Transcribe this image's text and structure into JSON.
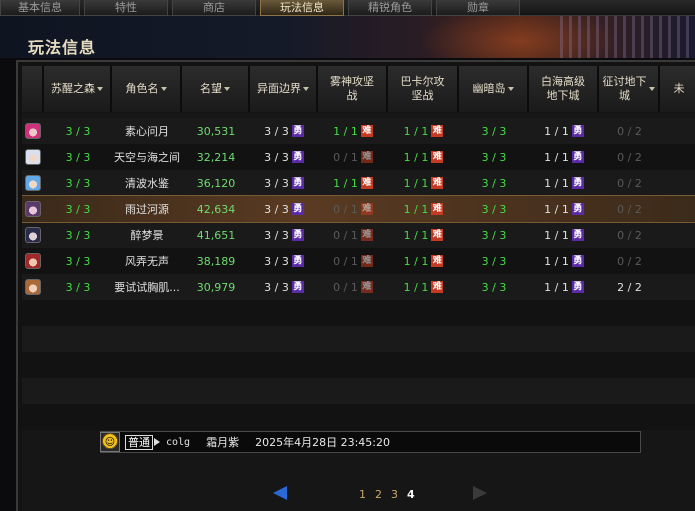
{
  "tabs": [
    {
      "label": "基本信息",
      "active": false
    },
    {
      "label": "特性",
      "active": false
    },
    {
      "label": "商店",
      "active": false
    },
    {
      "label": "玩法信息",
      "active": true
    },
    {
      "label": "精锐角色",
      "active": false
    },
    {
      "label": "勋章",
      "active": false
    }
  ],
  "page_title": "玩法信息",
  "table": {
    "headers": [
      "苏醒之森",
      "角色名",
      "名望",
      "异面边界",
      "雾神攻坚战",
      "巴卡尔攻坚战",
      "幽暗岛",
      "白海高级地下城",
      "征讨地下城",
      "未"
    ],
    "header_lines": [
      [
        "苏醒之森"
      ],
      [
        "角色名"
      ],
      [
        "名望"
      ],
      [
        "异面边界"
      ],
      [
        "雾神攻坚",
        "战"
      ],
      [
        "巴卡尔攻",
        "坚战"
      ],
      [
        "幽暗岛"
      ],
      [
        "白海高级",
        "地下城"
      ],
      [
        "征讨地下",
        "城"
      ],
      [
        "未"
      ]
    ],
    "rows": [
      {
        "avatar": "pink-hair",
        "forest": "3 / 3",
        "name": "素心问月",
        "fame": "30,531",
        "boundary": "3 / 3",
        "boundary_tag": "勇",
        "mist": "1 / 1",
        "mist_active": true,
        "mist_tag": "难",
        "bakal": "1 / 1",
        "bakal_tag": "难",
        "dark": "3 / 3",
        "white": "1 / 1",
        "white_tag": "勇",
        "conquest": "0 / 2"
      },
      {
        "avatar": "white-hair",
        "forest": "3 / 3",
        "name": "天空与海之间",
        "fame": "32,214",
        "boundary": "3 / 3",
        "boundary_tag": "勇",
        "mist": "0 / 1",
        "mist_active": false,
        "mist_tag": "难",
        "bakal": "1 / 1",
        "bakal_tag": "难",
        "dark": "3 / 3",
        "white": "1 / 1",
        "white_tag": "勇",
        "conquest": "0 / 2"
      },
      {
        "avatar": "blue-hair",
        "forest": "3 / 3",
        "name": "清波水鉴",
        "fame": "36,120",
        "boundary": "3 / 3",
        "boundary_tag": "勇",
        "mist": "1 / 1",
        "mist_active": true,
        "mist_tag": "难",
        "bakal": "1 / 1",
        "bakal_tag": "难",
        "dark": "3 / 3",
        "white": "1 / 1",
        "white_tag": "勇",
        "conquest": "0 / 2"
      },
      {
        "avatar": "dark-mage",
        "forest": "3 / 3",
        "name": "雨过河源",
        "fame": "42,634",
        "boundary": "3 / 3",
        "boundary_tag": "勇",
        "mist": "0 / 1",
        "mist_active": false,
        "mist_tag": "难",
        "bakal": "1 / 1",
        "bakal_tag": "难",
        "dark": "3 / 3",
        "white": "1 / 1",
        "white_tag": "勇",
        "conquest": "0 / 2",
        "selected": true
      },
      {
        "avatar": "dark-hat",
        "forest": "3 / 3",
        "name": "醉梦景",
        "fame": "41,651",
        "boundary": "3 / 3",
        "boundary_tag": "勇",
        "mist": "0 / 1",
        "mist_active": false,
        "mist_tag": "难",
        "bakal": "1 / 1",
        "bakal_tag": "难",
        "dark": "3 / 3",
        "white": "1 / 1",
        "white_tag": "勇",
        "conquest": "0 / 2"
      },
      {
        "avatar": "red-fighter",
        "forest": "3 / 3",
        "name": "风弄无声",
        "fame": "38,189",
        "boundary": "3 / 3",
        "boundary_tag": "勇",
        "mist": "0 / 1",
        "mist_active": false,
        "mist_tag": "难",
        "bakal": "1 / 1",
        "bakal_tag": "难",
        "dark": "3 / 3",
        "white": "1 / 1",
        "white_tag": "勇",
        "conquest": "0 / 2"
      },
      {
        "avatar": "brown-hair",
        "forest": "3 / 3",
        "name": "要试试胸肌...",
        "fame": "30,979",
        "boundary": "3 / 3",
        "boundary_tag": "勇",
        "mist": "0 / 1",
        "mist_active": false,
        "mist_tag": "难",
        "bakal": "1 / 1",
        "bakal_tag": "难",
        "dark": "3 / 3",
        "white": "1 / 1",
        "white_tag": "勇",
        "conquest": "2 / 2",
        "conquest_active": true
      }
    ]
  },
  "message": {
    "channel": "普通",
    "user": "colg",
    "name": "霜月紫",
    "time": "2025年4月28日 23:45:20"
  },
  "pagination": {
    "pages": [
      "1",
      "2",
      "3",
      "4"
    ],
    "current": "4"
  },
  "colors": {
    "green": "#44dd44",
    "grey": "#5a5a5a",
    "fame": "#6fdc6f",
    "brave_tag": "#5a2aa8",
    "hard_tag": "#c43a22",
    "active_tab": "#8a7448"
  }
}
